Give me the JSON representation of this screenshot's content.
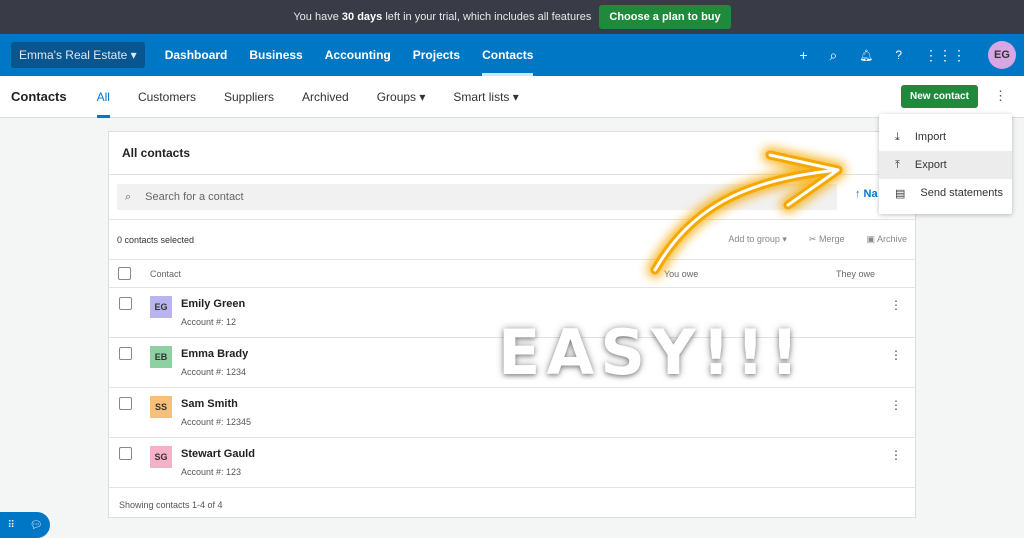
{
  "trial": {
    "prefix": "You have",
    "days": "30 days",
    "suffix": "left in your trial, which includes all features",
    "button": "Choose a plan to buy"
  },
  "nav": {
    "org": "Emma's Real Estate ▾",
    "items": [
      "Dashboard",
      "Business",
      "Accounting",
      "Projects",
      "Contacts"
    ],
    "active": "Contacts",
    "avatar": "EG"
  },
  "sub": {
    "title": "Contacts",
    "tabs": [
      "All",
      "Customers",
      "Suppliers",
      "Archived",
      "Groups ▾",
      "Smart lists ▾"
    ],
    "new_contact": "New contact"
  },
  "card": {
    "title": "All contacts",
    "search_placeholder": "Search for a contact",
    "sort": "↑ Na",
    "selected": "0 contacts selected",
    "actions": [
      "Add to group ▾",
      "Merge",
      "Archive"
    ],
    "columns": [
      "Contact",
      "You owe",
      "They owe"
    ],
    "rows": [
      {
        "initials": "EG",
        "name": "Emily Green",
        "account": "Account #: 12",
        "color": "#b9b4f0"
      },
      {
        "initials": "EB",
        "name": "Emma Brady",
        "account": "Account #: 1234",
        "color": "#8fd0a2"
      },
      {
        "initials": "SS",
        "name": "Sam Smith",
        "account": "Account #: 12345",
        "color": "#f7c07a"
      },
      {
        "initials": "SG",
        "name": "Stewart Gauld",
        "account": "Account #: 123",
        "color": "#f5b1c7"
      }
    ],
    "footer": "Showing contacts 1-4 of 4"
  },
  "menu": {
    "items": [
      {
        "label": "Import",
        "icon": "download-icon"
      },
      {
        "label": "Export",
        "icon": "upload-icon"
      },
      {
        "label": "Send statements",
        "icon": "document-icon"
      }
    ]
  },
  "overlay": {
    "text": "EASY!!!",
    "arrow_color": "#f5a800"
  }
}
